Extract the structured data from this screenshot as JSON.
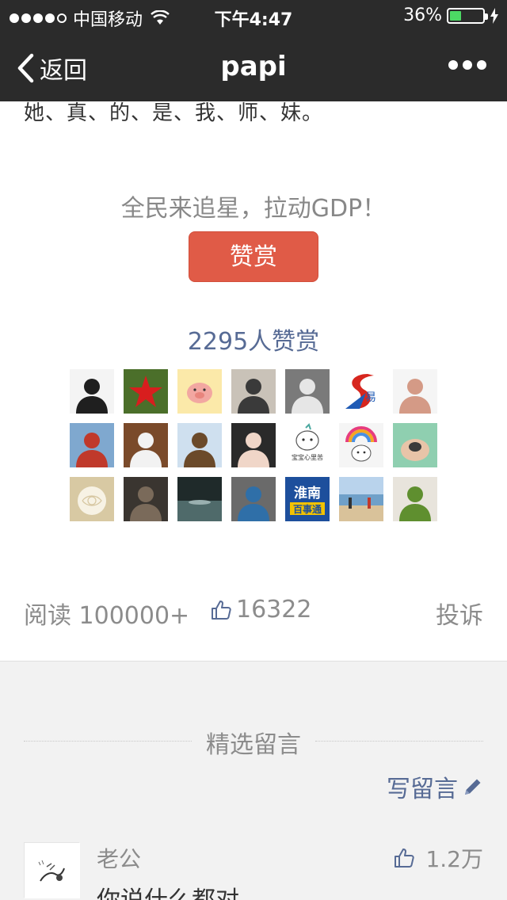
{
  "status_bar": {
    "carrier": "中国移动",
    "time": "下午4:47",
    "battery": "36%",
    "battery_level": 0.36
  },
  "nav": {
    "back_label": "返回",
    "title": "papi"
  },
  "article": {
    "last_line": "她、真、的、是、我、师、妹。"
  },
  "reward": {
    "slogan": "全民来追星，拉动GDP！",
    "button_label": "赞赏",
    "count": "2295",
    "count_suffix": "人赞赏",
    "avatars": [
      {
        "name": "avatar-glasses-man",
        "colors": [
          "#f4f4f4",
          "#1f1f1f"
        ]
      },
      {
        "name": "avatar-red-star",
        "colors": [
          "#4b6f2a",
          "#d81e1e"
        ]
      },
      {
        "name": "avatar-pink-pig",
        "colors": [
          "#fbe9a9",
          "#f2a7a1"
        ]
      },
      {
        "name": "avatar-office-man",
        "colors": [
          "#c9c2b8",
          "#3a3a3a"
        ]
      },
      {
        "name": "avatar-bw-woman",
        "colors": [
          "#7a7a7a",
          "#e6e6e6"
        ]
      },
      {
        "name": "avatar-yi-logo",
        "colors": [
          "#ffffff",
          "#d7261e"
        ]
      },
      {
        "name": "avatar-woman-white",
        "colors": [
          "#f5f5f5",
          "#d49a86"
        ]
      },
      {
        "name": "avatar-sea-person",
        "colors": [
          "#7fa8cf",
          "#c0392b"
        ]
      },
      {
        "name": "avatar-cards",
        "colors": [
          "#7a4a2a",
          "#f2f2f2"
        ]
      },
      {
        "name": "avatar-horse-rider",
        "colors": [
          "#cfe0ef",
          "#6b4a2a"
        ]
      },
      {
        "name": "avatar-woman-dark",
        "colors": [
          "#2a2a2a",
          "#f0d6c8"
        ]
      },
      {
        "name": "avatar-cartoon-cat",
        "colors": [
          "#ffffff",
          "#4ba8a0"
        ]
      },
      {
        "name": "avatar-rainbow-cat",
        "colors": [
          "#f5f5f5",
          "#e73c7e"
        ]
      },
      {
        "name": "avatar-hands-turtle",
        "colors": [
          "#8fcfb0",
          "#3b3b3b"
        ]
      },
      {
        "name": "avatar-white-rose",
        "colors": [
          "#d8c9a3",
          "#f7f2e4"
        ]
      },
      {
        "name": "avatar-dark-animal",
        "colors": [
          "#3a3530",
          "#7a6a5a"
        ]
      },
      {
        "name": "avatar-water-night",
        "colors": [
          "#1f2a2a",
          "#4f6a6a"
        ]
      },
      {
        "name": "avatar-group-room",
        "colors": [
          "#6a6a6a",
          "#2f6fa8"
        ]
      },
      {
        "name": "avatar-huainan-logo",
        "colors": [
          "#1d4f9c",
          "#ffffff"
        ]
      },
      {
        "name": "avatar-beach",
        "colors": [
          "#8ab6dd",
          "#d9c29a"
        ]
      },
      {
        "name": "avatar-man-green",
        "colors": [
          "#e8e4dc",
          "#5f8f2f"
        ]
      }
    ],
    "huainan_text": "淮南",
    "huainan_sub": "百事通",
    "yi_text": "易",
    "cartoon_text": "宝宝心里苦"
  },
  "stats": {
    "read": "阅读 100000+",
    "likes": "16322",
    "report": "投诉"
  },
  "comments": {
    "title": "精选留言",
    "write_label": "写留言",
    "items": [
      {
        "name": "老公",
        "text": "你说什么都对",
        "likes": "1.2万"
      }
    ]
  },
  "colors": {
    "bar_bg": "#2b2b2b",
    "accent_red": "#e05b47",
    "link_blue": "#576b95",
    "muted": "#8c8c8c",
    "comment_bg": "#f2f2f2"
  }
}
